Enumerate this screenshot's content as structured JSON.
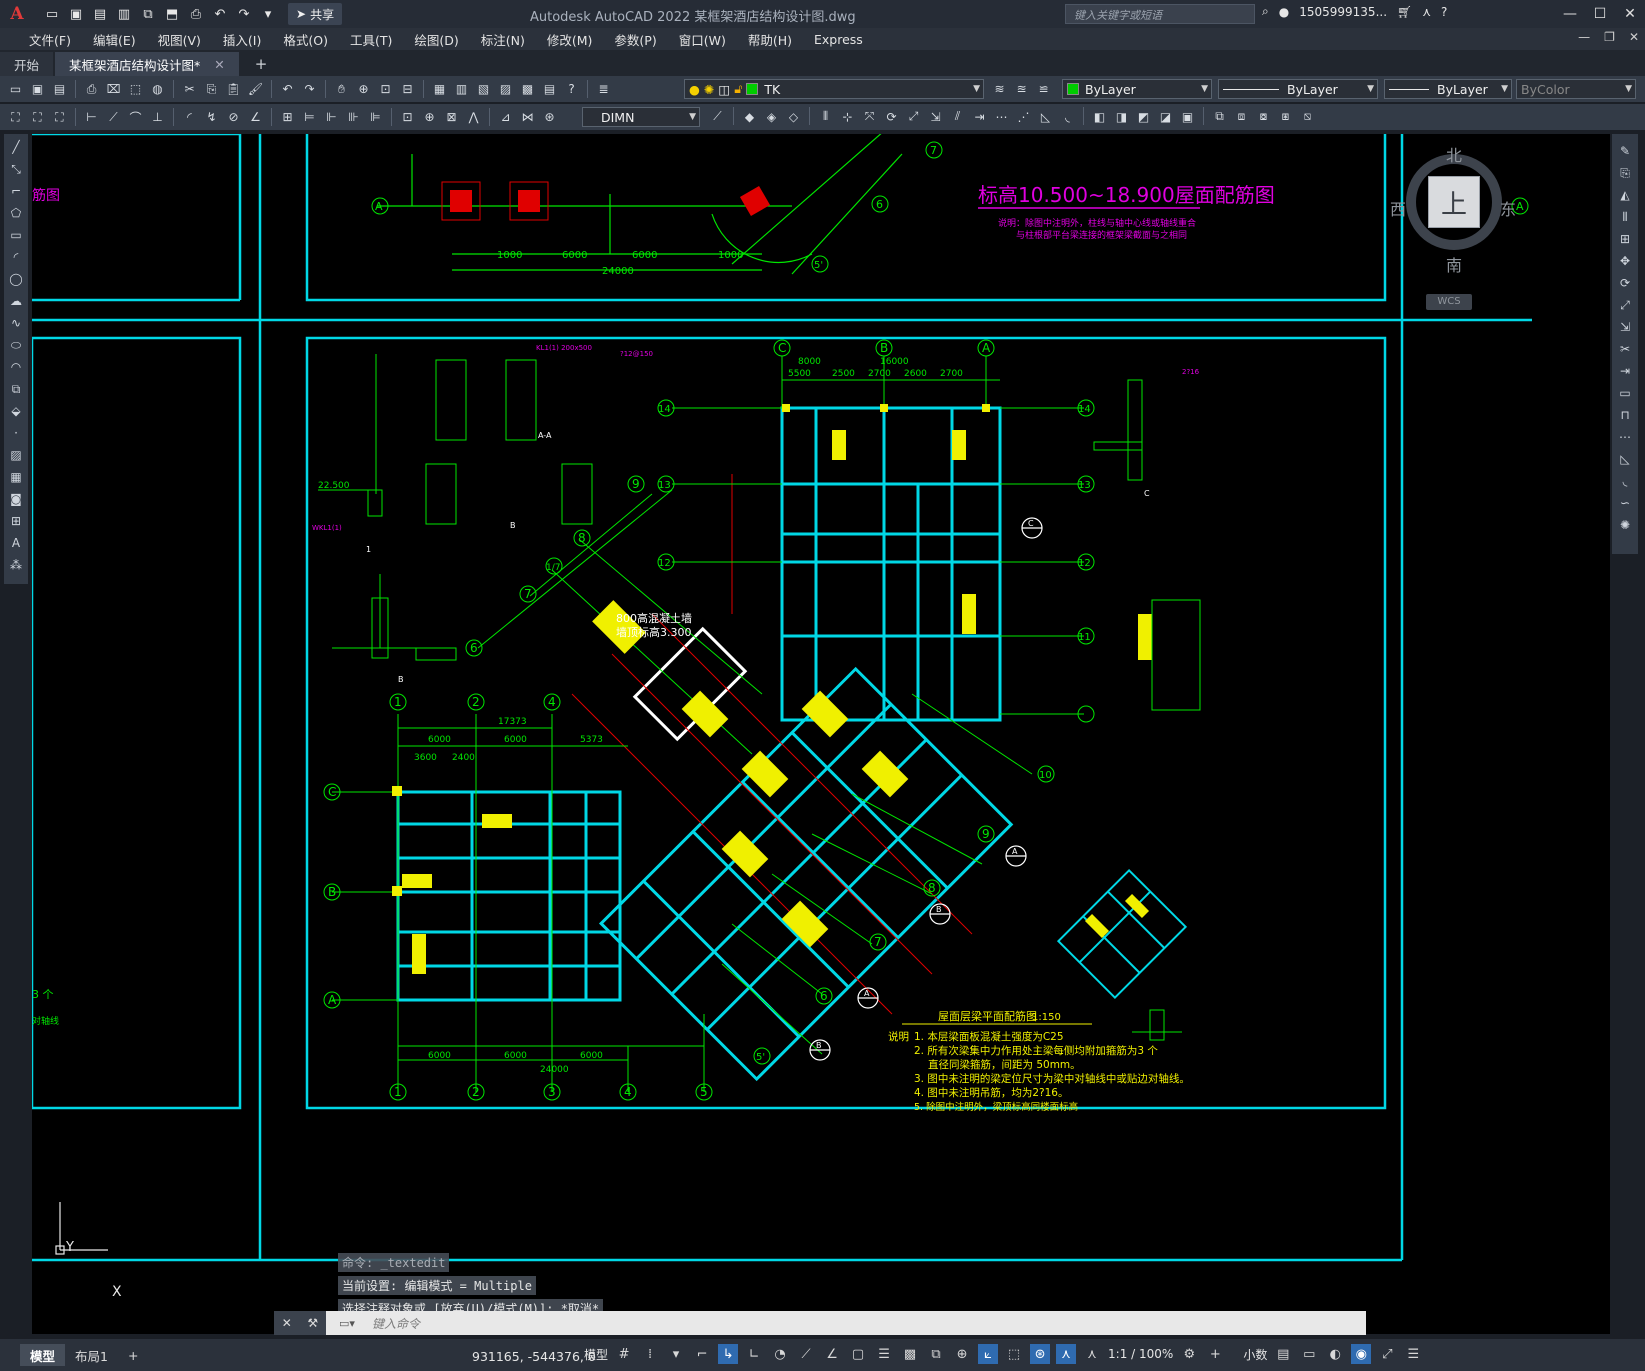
{
  "titlebar": {
    "logo": "A",
    "share_label": "共享",
    "title": "Autodesk AutoCAD 2022    某框架酒店结构设计图.dwg",
    "search_placeholder": "键入关键字或短语",
    "user": "1505999135..."
  },
  "menus": [
    "文件(F)",
    "编辑(E)",
    "视图(V)",
    "插入(I)",
    "格式(O)",
    "工具(T)",
    "绘图(D)",
    "标注(N)",
    "修改(M)",
    "参数(P)",
    "窗口(W)",
    "帮助(H)",
    "Express"
  ],
  "tabs": [
    {
      "label": "开始"
    },
    {
      "label": "某框架酒店结构设计图*"
    }
  ],
  "properties": {
    "layer": "TK",
    "color": "ByLayer",
    "linetype": "ByLayer",
    "lineweight": "ByLayer",
    "plotstyle": "ByColor",
    "dimstyle": "DIMN",
    "layer_swatch": "#00cc00",
    "color_swatch": "#00cc00"
  },
  "viewcube": {
    "north": "北",
    "south": "南",
    "east": "东",
    "west": "西",
    "top": "上",
    "wcs": "WCS"
  },
  "drawing": {
    "upper_title": "标高10.500~18.900屋面配筋图",
    "upper_note1": "说明：除图中注明外，柱线与轴中心线或轴线重合",
    "upper_note2": "与柱根部平台梁连接的框架梁截面与之相同",
    "main_title": "屋面层梁平面配筋图",
    "main_scale": "1:150",
    "wall_note1": "800高混凝土墙",
    "wall_note2": "墙顶标高3.300",
    "level_mark": "22.500",
    "notes_header": "说明",
    "notes": [
      "1. 本层梁面板混凝土强度为C25",
      "2. 所有次梁集中力作用处主梁每侧均附加箍筋为3 个",
      "直径同梁箍筋，间距为 50mm。",
      "3. 图中未注明的梁定位尺寸为梁中对轴线中或贴边对轴线。",
      "4. 图中未注明吊筋，均为2?16。",
      "5. 除图中注明外，梁顶标高同楼面标高"
    ],
    "axis_labels_bottom": [
      "1",
      "2",
      "3",
      "4",
      "5"
    ],
    "dims_bottom": [
      "6000",
      "6000",
      "6000",
      "24000"
    ],
    "dims_top_left": [
      "6000",
      "6000",
      "5373",
      "17373",
      "3600",
      "2400"
    ],
    "axis_labels_left": [
      "C",
      "B",
      "A"
    ],
    "axis_labels_right": [
      "14",
      "13",
      "12",
      "11",
      "A'"
    ],
    "axis_labels_top_right": [
      "C",
      "B",
      "A"
    ],
    "dims_top_right": [
      "5500",
      "2500",
      "2700",
      "2600",
      "2700",
      "8000",
      "16000"
    ],
    "axis_labels_diag": [
      "9",
      "8",
      "7",
      "6",
      "5'",
      "10",
      "1/7"
    ],
    "section_labels": [
      "A-A",
      "B",
      "B'",
      "C",
      "C'",
      "D'"
    ],
    "left_note1": "3 个",
    "left_note2": "对轴线"
  },
  "ucs": {
    "x": "X",
    "y": "Y"
  },
  "command": {
    "history": [
      "命令: _textedit",
      "当前设置: 编辑模式 = Multiple",
      "选择注释对象或 [放弃(U)/模式(M)]: *取消*"
    ],
    "placeholder": "键入命令"
  },
  "status": {
    "layout_tabs": [
      "模型",
      "布局1"
    ],
    "coords": "931165, -544376, 0",
    "model_label": "模型",
    "scale": "1:1 / 100%",
    "units": "小数"
  }
}
